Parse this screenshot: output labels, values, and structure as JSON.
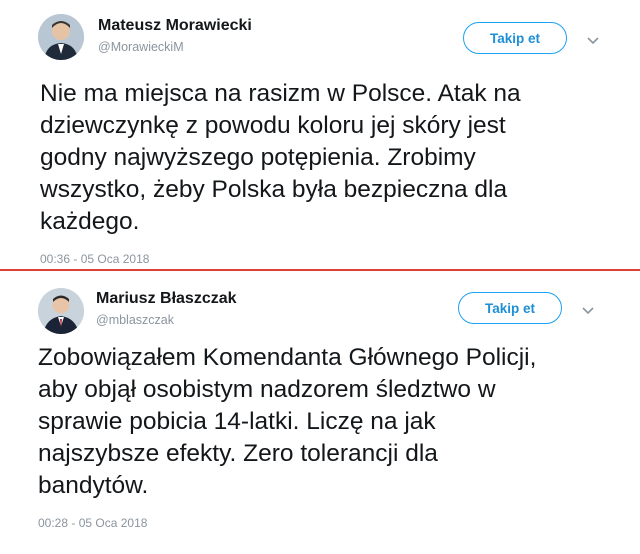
{
  "colors": {
    "accent": "#1da1f2",
    "divider": "#e0403c"
  },
  "tweets": [
    {
      "author": {
        "name": "Mateusz Morawiecki",
        "handle": "@MorawieckiM",
        "avatar_icon": "profile-photo"
      },
      "follow_label": "Takip et",
      "menu_icon": "chevron-down-icon",
      "text_lines": [
        "Nie ma miejsca na rasizm w Polsce. Atak na",
        "dziewczynkę z powodu koloru jej skóry jest",
        "godny najwyższego potępienia. Zrobimy",
        "wszystko, żeby Polska była bezpieczna dla",
        "każdego."
      ],
      "timestamp": "00:36 - 05 Oca 2018"
    },
    {
      "author": {
        "name": "Mariusz Błaszczak",
        "handle": "@mblaszczak",
        "avatar_icon": "profile-photo"
      },
      "follow_label": "Takip et",
      "menu_icon": "chevron-down-icon",
      "text_lines": [
        "Zobowiązałem Komendanta Głównego Policji,",
        "aby objął osobistym nadzorem śledztwo w",
        "sprawie pobicia 14-latki. Liczę na jak",
        "najszybsze efekty. Zero tolerancji dla",
        "bandytów."
      ],
      "timestamp": "00:28 - 05 Oca 2018"
    }
  ]
}
